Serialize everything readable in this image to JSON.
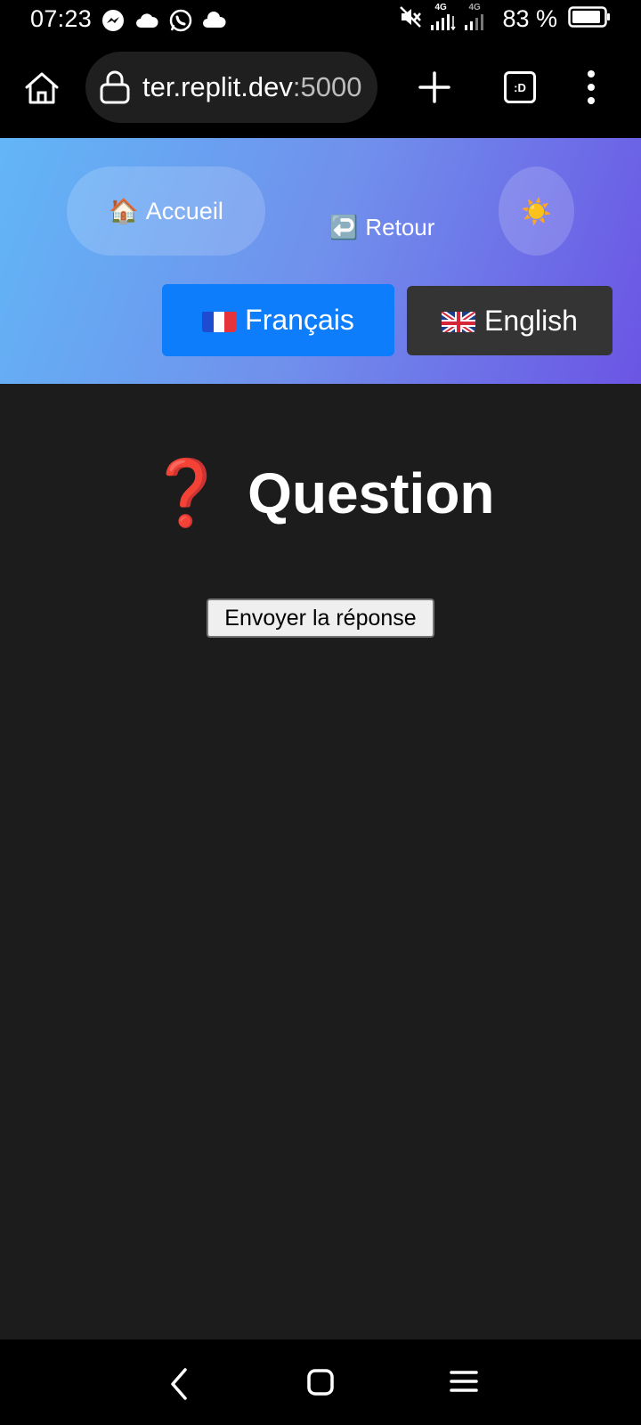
{
  "status_bar": {
    "time": "07:23",
    "network_tag_1": "4G",
    "network_tag_2": "4G",
    "battery": "83 %"
  },
  "browser": {
    "url_host": "ter.replit.dev",
    "url_port": ":5000",
    "tabs_label": ":D"
  },
  "header": {
    "accueil_emoji": "🏠",
    "accueil_label": "Accueil",
    "retour_emoji": "↩️",
    "retour_label": "Retour",
    "theme_emoji": "☀️",
    "lang_fr_label": "Français",
    "lang_en_label": "English"
  },
  "main": {
    "title_emoji": "❓",
    "title": "Question",
    "submit_label": "Envoyer la réponse"
  },
  "colors": {
    "header_gradient_start": "#62b6f7",
    "header_gradient_end": "#6b55e4",
    "active_lang": "#0d7dfb",
    "inactive_lang": "#343434",
    "page_bg": "#1c1c1c"
  },
  "icons": [
    "home-icon",
    "lock-icon",
    "plus-icon",
    "tabs-icon",
    "more-vertical-icon",
    "back-icon",
    "home-nav-icon",
    "recents-icon"
  ]
}
